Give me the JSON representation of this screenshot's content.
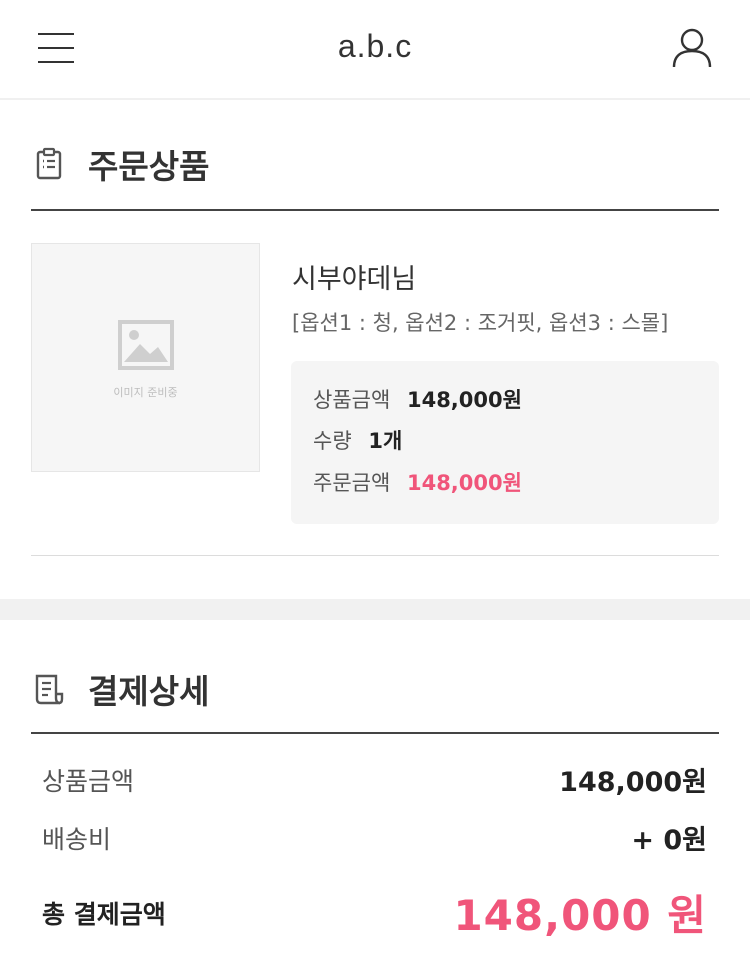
{
  "header": {
    "title": "a.b.c",
    "menu_icon": "hamburger-menu-icon",
    "user_icon": "user-icon"
  },
  "order_section": {
    "title": "주문상품",
    "icon": "clipboard-icon"
  },
  "product": {
    "thumbnail_text": "이미지 준비중",
    "name": "시부야데님",
    "options": "[옵션1 : 청, 옵션2 : 조거핏, 옵션3 : 스몰]",
    "price_label": "상품금액",
    "price_value": "148,000원",
    "qty_label": "수량",
    "qty_value": "1개",
    "order_label": "주문금액",
    "order_value": "148,000원"
  },
  "payment_section": {
    "title": "결제상세",
    "icon": "receipt-icon",
    "rows": [
      {
        "label": "상품금액",
        "value": "148,000원"
      },
      {
        "label": "배송비",
        "value": "+ 0원"
      }
    ],
    "total_label": "총 결제금액",
    "total_value": "148,000 원"
  },
  "colors": {
    "accent": "#f0557a",
    "text": "#222222",
    "muted": "#666666",
    "box_bg": "#f5f5f5"
  }
}
